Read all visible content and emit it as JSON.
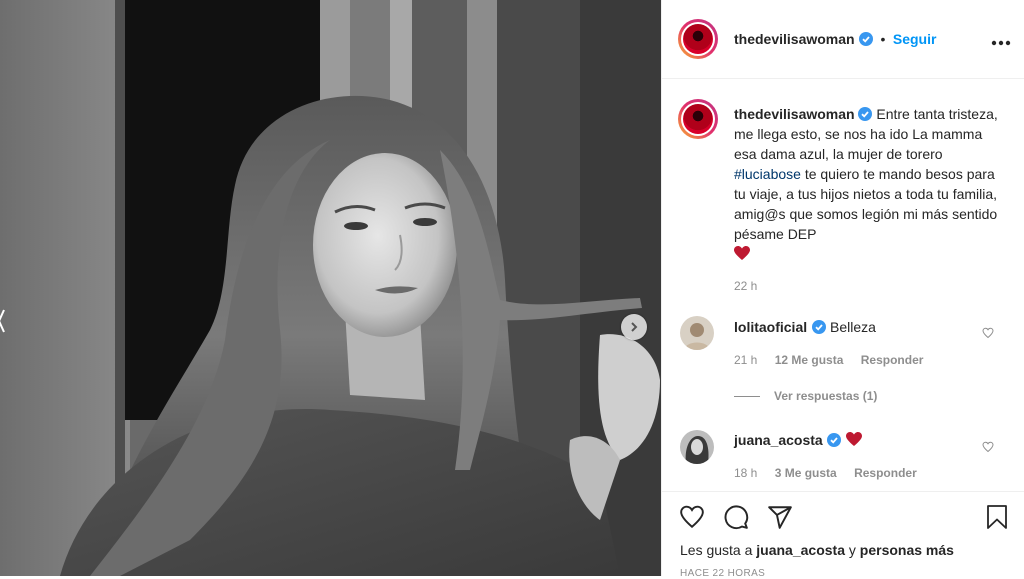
{
  "post": {
    "username": "thedevilisawoman",
    "follow_label": "Seguir",
    "separator": "•",
    "more_label": "•••"
  },
  "caption": {
    "username": "thedevilisawoman",
    "text_before": "Entre tanta tristeza, me llega esto, se nos ha ido La mamma esa dama azul, la mujer de torero ",
    "hashtag": "#luciabose",
    "text_after": " te quiero te mando besos para tu viaje, a tus hijos nietos a toda tu familia, amig@s que somos legión mi más sentido pésame DEP",
    "emoji": "heart-emoji",
    "time": "22 h"
  },
  "comments": [
    {
      "username": "lolitaoficial",
      "text": "Belleza",
      "time": "21 h",
      "likes": "12 Me gusta",
      "reply": "Responder",
      "view_replies": "Ver respuestas (1)"
    },
    {
      "username": "juana_acosta",
      "text": "",
      "emoji": "heart-emoji",
      "time": "18 h",
      "likes": "3 Me gusta",
      "reply": "Responder"
    }
  ],
  "footer": {
    "likes_prefix": "Les gusta a ",
    "likes_user": "juana_acosta",
    "likes_mid": " y ",
    "likes_rest": "personas más",
    "timestamp": "HACE 22 HORAS"
  },
  "icons": [
    "heart-icon",
    "comment-icon",
    "share-icon",
    "bookmark-icon",
    "chevron-right-icon",
    "verified-icon",
    "more-icon"
  ],
  "colors": {
    "link": "#0095f6",
    "hashtag": "#00376b",
    "heart": "#ed4956",
    "muted": "#8e8e8e"
  }
}
